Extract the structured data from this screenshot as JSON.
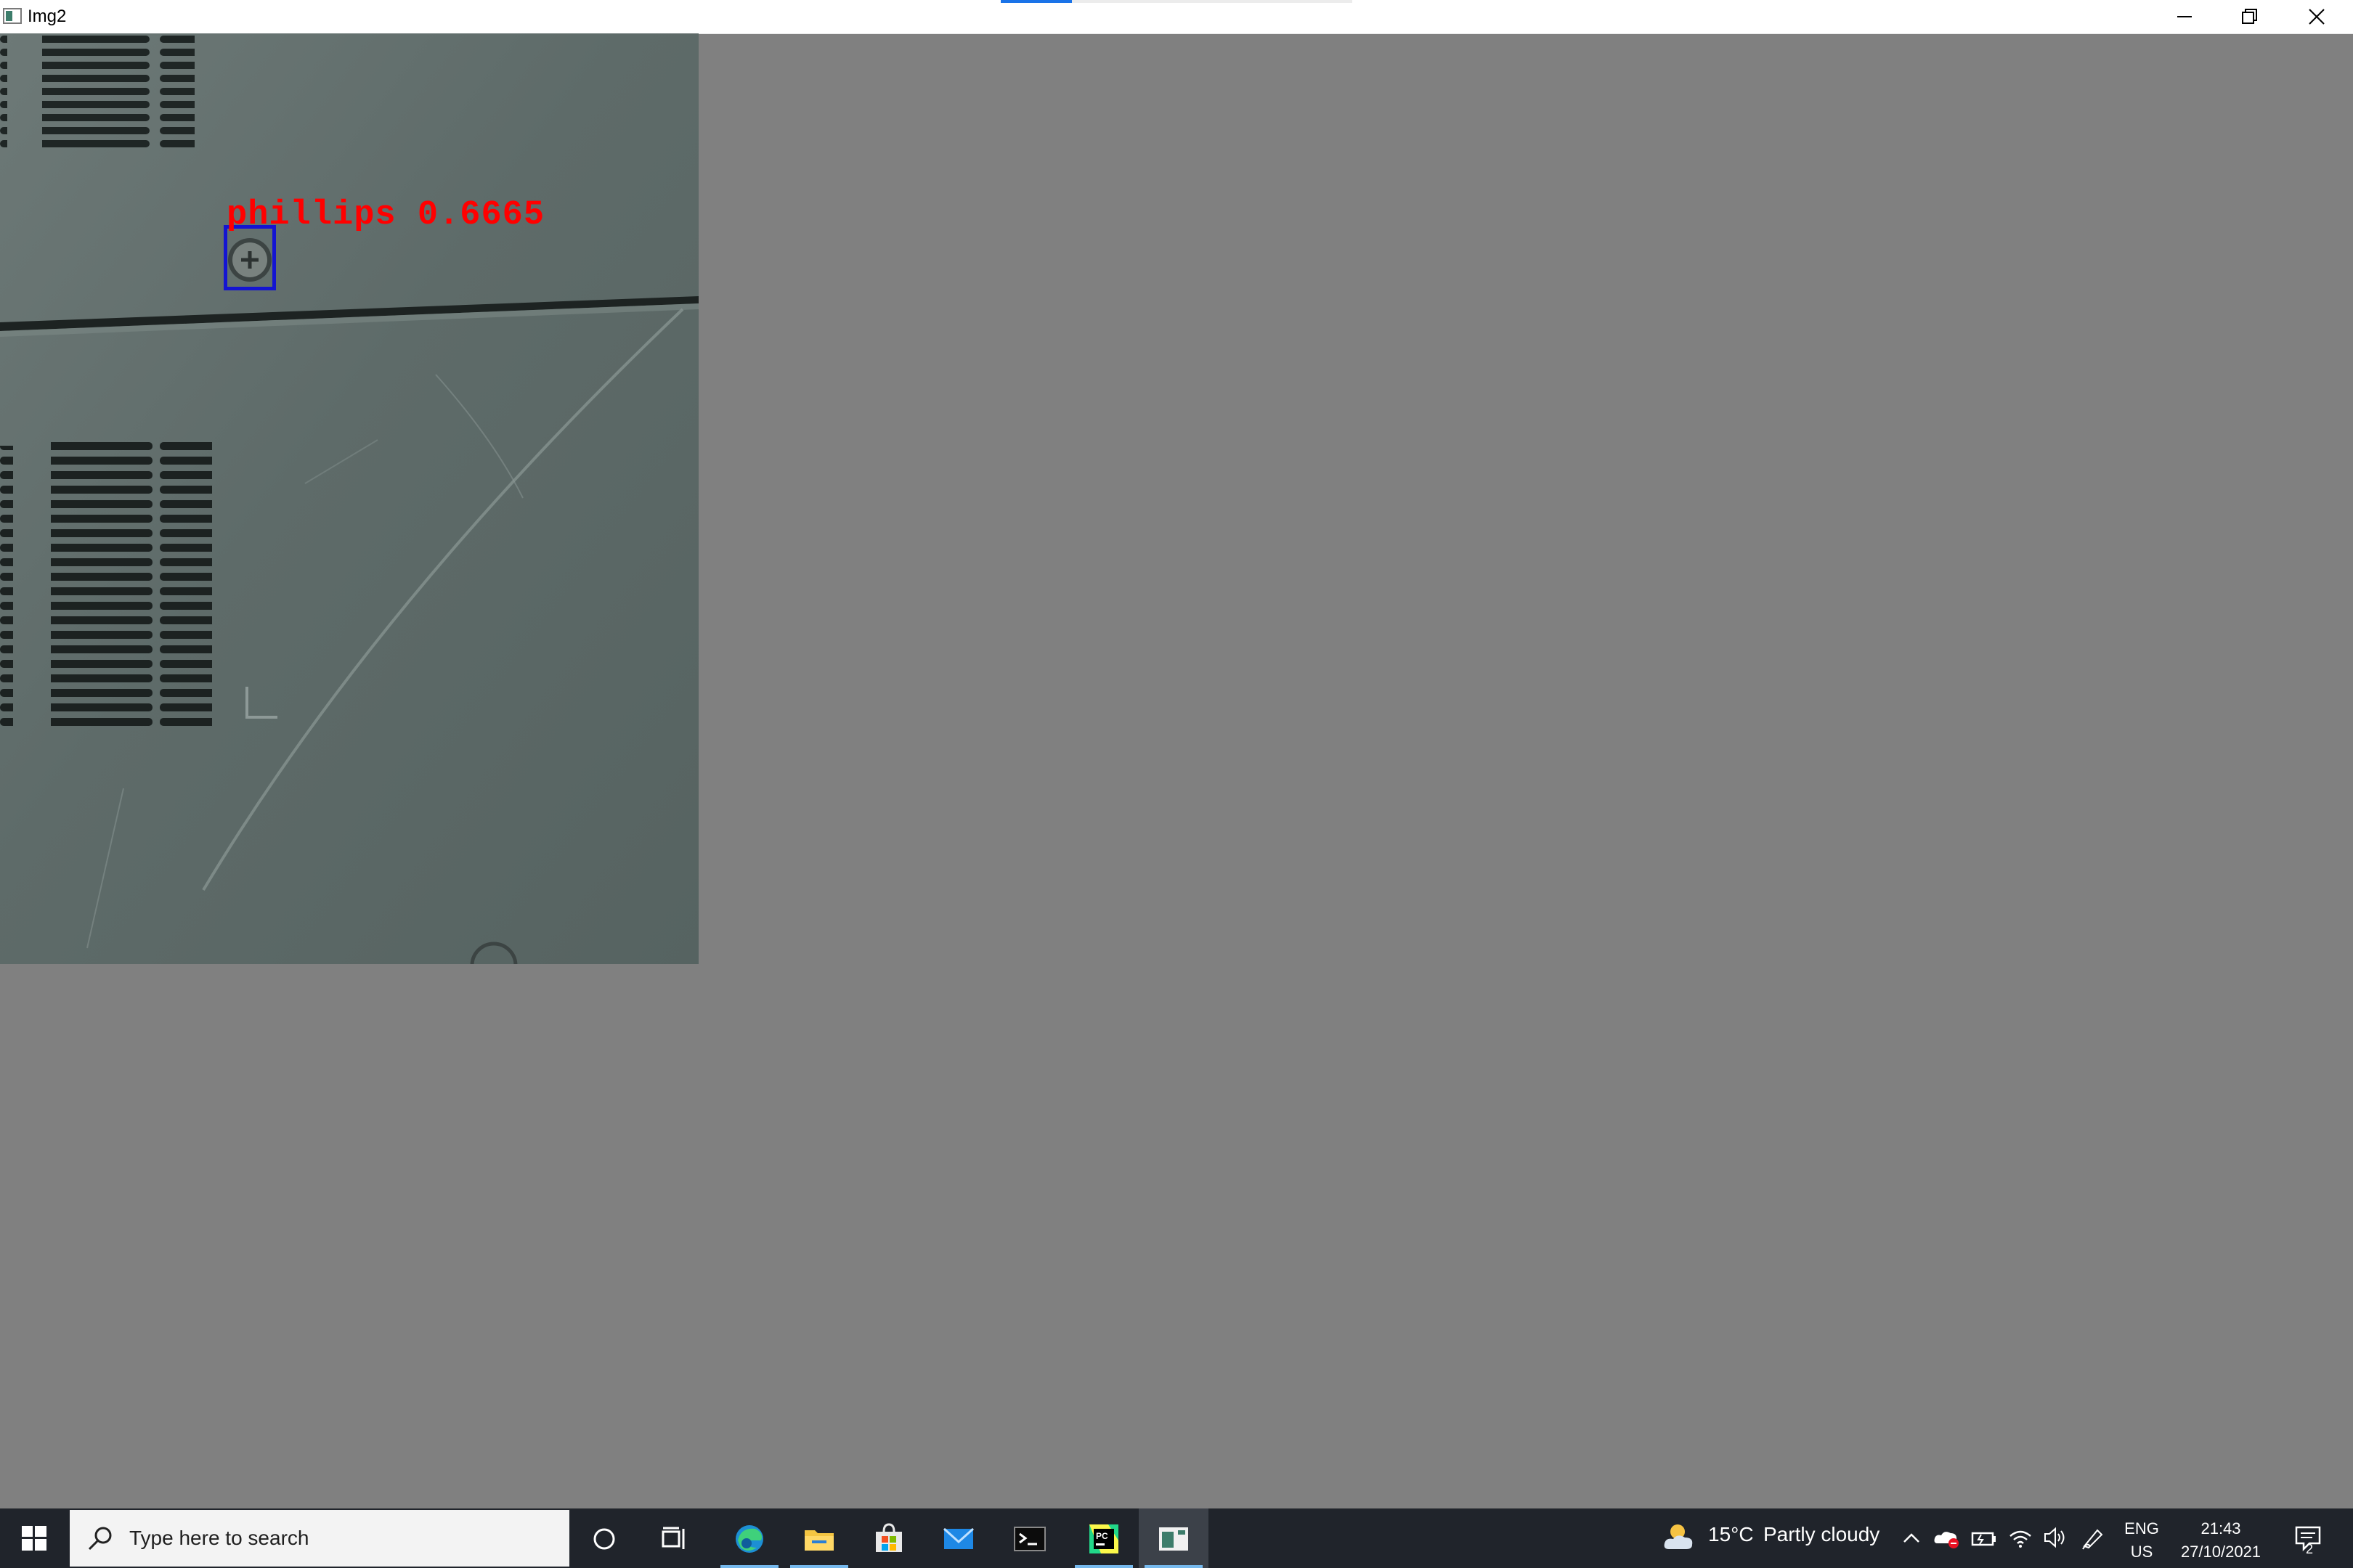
{
  "window": {
    "title": "Img2"
  },
  "detection": {
    "label": "phillips 0.6665",
    "label_color": "#ff0000",
    "box_color": "#1414d2"
  },
  "taskbar": {
    "search_placeholder": "Type here to search",
    "pinned": [
      {
        "name": "cortana"
      },
      {
        "name": "task-view"
      },
      {
        "name": "edge"
      },
      {
        "name": "file-explorer"
      },
      {
        "name": "microsoft-store"
      },
      {
        "name": "mail"
      },
      {
        "name": "terminal"
      },
      {
        "name": "pycharm"
      },
      {
        "name": "img2-window"
      }
    ],
    "weather": {
      "temp": "15°C",
      "condition": "Partly cloudy"
    },
    "language": {
      "line1": "ENG",
      "line2": "US"
    },
    "clock": {
      "time": "21:43",
      "date": "27/10/2021"
    },
    "notification_count": "2"
  },
  "colors": {
    "background": "#808080",
    "taskbar": "#20242b",
    "accent": "#76b9ed"
  }
}
